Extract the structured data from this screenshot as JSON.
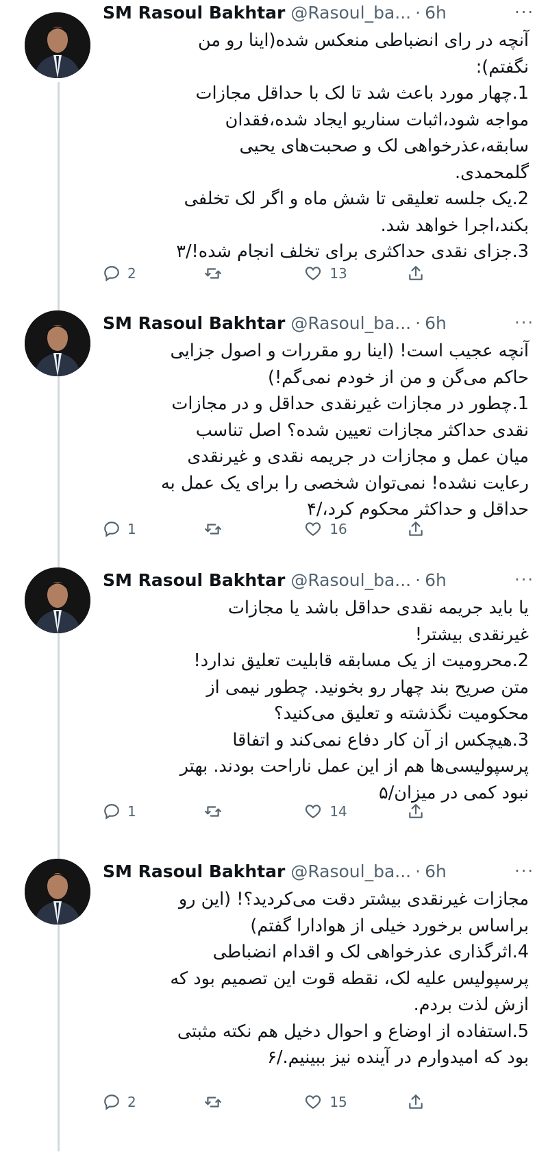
{
  "author": {
    "name": "SM Rasoul Bakhtar",
    "handle": "@Rasoul_ba...",
    "separator": "·",
    "more_label": "···"
  },
  "tweets": [
    {
      "time": "6h",
      "lines": [
        "آنچه در رای انضباطی منعکس شده(اینا رو من",
        "نگفتم):",
        "1.چهار مورد باعث شد تا لک با حداقل مجازات",
        "مواجه شود،اثبات سناریو ایجاد شده،فقدان",
        "سابقه،عذرخواهی لک و صحبت‌های یحیی",
        "گلمحمدی.",
        "2.یک جلسه تعلیقی تا شش ماه و اگر لک تخلفی",
        "بکند،اجرا خواهد شد.",
        "3.جزای نقدی حداکثری برای تخلف انجام شده!/۳"
      ],
      "replies": "2",
      "retweets": "",
      "likes": "13"
    },
    {
      "time": "6h",
      "lines": [
        "آنچه عجیب است! (اینا رو مقررات و اصول جزایی",
        "حاکم می‌گن و من از خودم نمی‌گم!)",
        "1.چطور در مجازات غیرنقدی حداقل و در مجازات",
        "نقدی حداکثر مجازات تعیین شده؟ اصل تناسب",
        "میان عمل و مجازات در جریمه نقدی و غیرنقدی",
        "رعایت نشده! نمی‌توان شخصی را برای یک عمل به",
        "حداقل و حداکثر محکوم کرد،/۴"
      ],
      "replies": "1",
      "retweets": "",
      "likes": "16"
    },
    {
      "time": "6h",
      "lines": [
        "یا باید جریمه نقدی حداقل باشد یا مجازات",
        "غیرنقدی بیشتر!",
        "2.محرومیت از یک مسابقه قابلیت تعلیق ندارد!",
        "متن صریح بند چهار رو بخونید. چطور نیمی از",
        "محکومیت نگذشته و تعلیق می‌کنید؟",
        "3.هیچکس از آن کار دفاع نمی‌کند و اتفاقا",
        "پرسپولیسی‌ها هم از این عمل ناراحت بودند. بهتر",
        "نبود کمی در میزان/۵"
      ],
      "replies": "1",
      "retweets": "",
      "likes": "14"
    },
    {
      "time": "6h",
      "lines": [
        "مجازات غیرنقدی بیشتر دقت می‌کردید؟! (این رو",
        "براساس برخورد خیلی از هوادارا گفتم)",
        "4.اثرگذاری عذرخواهی لک و اقدام انضباطی",
        "پرسپولیس علیه لک، نقطه قوت این تصمیم بود که",
        "ازش لذت بردم.",
        "5.استفاده از اوضاع و احوال دخیل هم نکته مثبتی",
        "بود که امیدوارم در آینده نیز ببینیم./۶"
      ],
      "replies": "2",
      "retweets": "",
      "likes": "15"
    }
  ],
  "icons": {
    "reply": "reply-icon",
    "retweet": "retweet-icon",
    "like": "heart-icon",
    "share": "share-icon",
    "more": "more-icon"
  },
  "colors": {
    "text": "#0f1419",
    "secondary": "#536471",
    "thread_line": "#cfd9de",
    "background": "#ffffff"
  }
}
